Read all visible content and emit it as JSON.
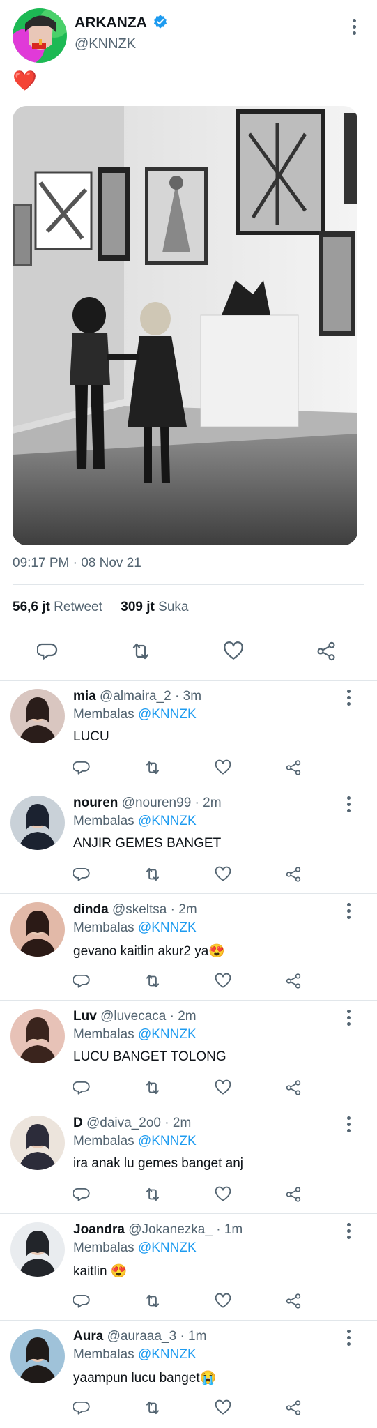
{
  "tweet": {
    "author_name": "ARKANZA",
    "author_handle": "@KNNZK",
    "heart_emoji": "❤️",
    "timestamp": "09:17 PM · 08 Nov 21",
    "retweet_count": "56,6 jt",
    "retweet_label": "Retweet",
    "like_count": "309 jt",
    "like_label": "Suka"
  },
  "reply_prefix": "Membalas",
  "reply_target": "@KNNZK",
  "replies": [
    {
      "name": "mia",
      "handle": "@almaira_2",
      "time": "· 3m",
      "text": "LUCU",
      "emoji": ""
    },
    {
      "name": "nouren",
      "handle": "@nouren99",
      "time": "· 2m",
      "text": "ANJIR GEMES BANGET",
      "emoji": ""
    },
    {
      "name": "dinda",
      "handle": "@skeltsa",
      "time": "· 2m",
      "text": "gevano kaitlin akur2 ya",
      "emoji": "😍"
    },
    {
      "name": "Luv",
      "handle": "@luvecaca",
      "time": "· 2m",
      "text": "LUCU BANGET TOLONG",
      "emoji": ""
    },
    {
      "name": "D",
      "handle": "@daiva_2o0",
      "time": "· 2m",
      "text": "ira anak lu gemes banget anj",
      "emoji": ""
    },
    {
      "name": "Joandra",
      "handle": "@Jokanezka_",
      "time": "· 1m",
      "text": "kaitlin ",
      "emoji": "😍"
    },
    {
      "name": "Aura",
      "handle": "@auraaa_3",
      "time": "· 1m",
      "text": "yaampun lucu banget",
      "emoji": "😭"
    }
  ],
  "icons": {
    "reply": "speech-bubble-icon",
    "retweet": "retweet-icon",
    "like": "heart-outline-icon",
    "share": "share-icon",
    "verified": "verified-badge-icon",
    "more": "more-vertical-icon"
  },
  "colors": {
    "accent": "#1d9bf0",
    "text": "#0f1419",
    "muted": "#536471"
  }
}
